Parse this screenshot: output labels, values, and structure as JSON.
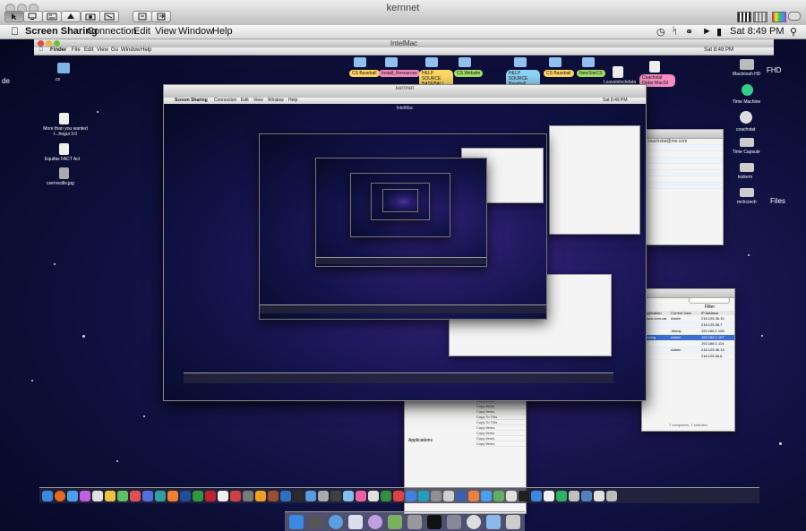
{
  "window": {
    "title": "kernnet",
    "toolbar_icons": [
      "pointer-mode-icon",
      "remote-control-icon",
      "scaling-icon",
      "share-icon",
      "capture-icon",
      "fullscreen-icon",
      "clipboard-get-icon",
      "clipboard-send-icon"
    ]
  },
  "menubar": {
    "app": "Screen Sharing",
    "items": [
      "Connection",
      "Edit",
      "View",
      "Window",
      "Help"
    ],
    "clock": "Sat 8:49 PM"
  },
  "remote": {
    "title": "IntelMac",
    "menubar": {
      "finder": "Finder",
      "items": [
        "File",
        "Edit",
        "View",
        "Go",
        "Window",
        "Help"
      ],
      "clock": "Sat 8:49 PM"
    },
    "desktop_labels": [
      "Macintosh HD",
      "Time Machine",
      "coachstat",
      "Time Capsule",
      "leskern",
      "mchcrech",
      "FHD"
    ],
    "folder_labels": [
      "CS Baseball",
      "Install_Resources",
      "HELP SOURCE BASEBALL",
      "CS Website",
      "HELP SOURCE Baseball",
      "CS Baseball",
      "NewSiteCS",
      "Coachstat Order Mac03"
    ],
    "left_labels": [
      "de",
      "cs",
      "More than you wanted t...hogui 3.0",
      "Equifax FACT Act",
      "cservscills.jpg",
      "Lsavatstockdata",
      "Files"
    ]
  },
  "nested": {
    "title": "kernnet",
    "app": "Screen Sharing",
    "items": [
      "Connection",
      "Edit",
      "View",
      "Window",
      "Help"
    ],
    "remote_title": "IntelMac",
    "clock": "Sat 8:49 PM"
  },
  "mail": {
    "account": "coachstat@me.com"
  },
  "network": {
    "filter_label": "Filter",
    "columns": [
      "Application",
      "Current User",
      "IP Address"
    ],
    "rows": [
      [
        "",
        ".cisco.com.cat",
        "Admin",
        "216.125.36.15"
      ],
      [
        "",
        "",
        "",
        "216.125.36.7"
      ],
      [
        "",
        "",
        "Jimmy",
        "192.168.1.108"
      ],
      [
        "",
        "sharing",
        "Admin",
        "192.168.1.107"
      ],
      [
        "",
        "",
        "",
        "192.168.1.114"
      ],
      [
        "",
        "",
        "Admin",
        "216.125.36.13"
      ],
      [
        "",
        "",
        "",
        "216.125.36.6"
      ]
    ],
    "footer": "7 computers, 1 selected"
  },
  "copy_items": [
    "Copy Items",
    "Copy Items",
    "Copy Items",
    "Copy To This",
    "Copy To This",
    "Copy Items",
    "Copy Items",
    "Copy Items",
    "Copy Items"
  ],
  "applications_label": "Applications"
}
